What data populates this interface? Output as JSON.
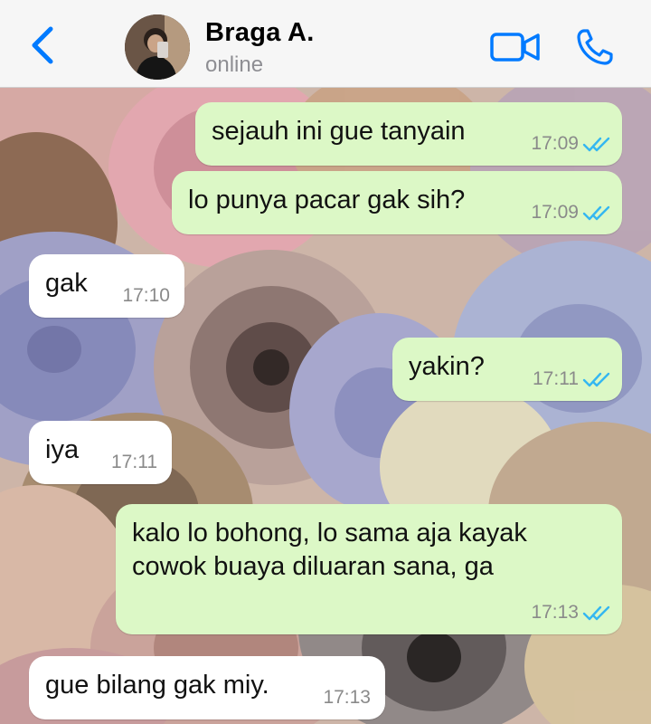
{
  "header": {
    "back_icon": "chevron-left-icon",
    "contact_name": "Braga A.",
    "contact_status": "online",
    "video_icon": "video-camera-icon",
    "phone_icon": "phone-icon",
    "accent_color": "#007aff"
  },
  "messages": [
    {
      "direction": "outgoing",
      "text": "sejauh ini gue tanyain",
      "time": "17:09",
      "status_icon": "double-check-icon"
    },
    {
      "direction": "outgoing",
      "text": "lo punya pacar gak sih?",
      "time": "17:09",
      "status_icon": "double-check-icon"
    },
    {
      "direction": "incoming",
      "text": "gak",
      "time": "17:10"
    },
    {
      "direction": "outgoing",
      "text": "yakin?",
      "time": "17:11",
      "status_icon": "double-check-icon"
    },
    {
      "direction": "incoming",
      "text": "iya",
      "time": "17:11"
    },
    {
      "direction": "outgoing",
      "lines": [
        "kalo lo bohong, lo sama aja kayak",
        "cowok buaya diluaran sana, ga"
      ],
      "time": "17:13",
      "status_icon": "double-check-icon"
    },
    {
      "direction": "incoming",
      "text": "gue bilang gak miy.",
      "time": "17:13"
    }
  ],
  "colors": {
    "outgoing_bubble": "#dcf8c6",
    "incoming_bubble": "#ffffff",
    "read_ticks": "#34b7f1"
  }
}
